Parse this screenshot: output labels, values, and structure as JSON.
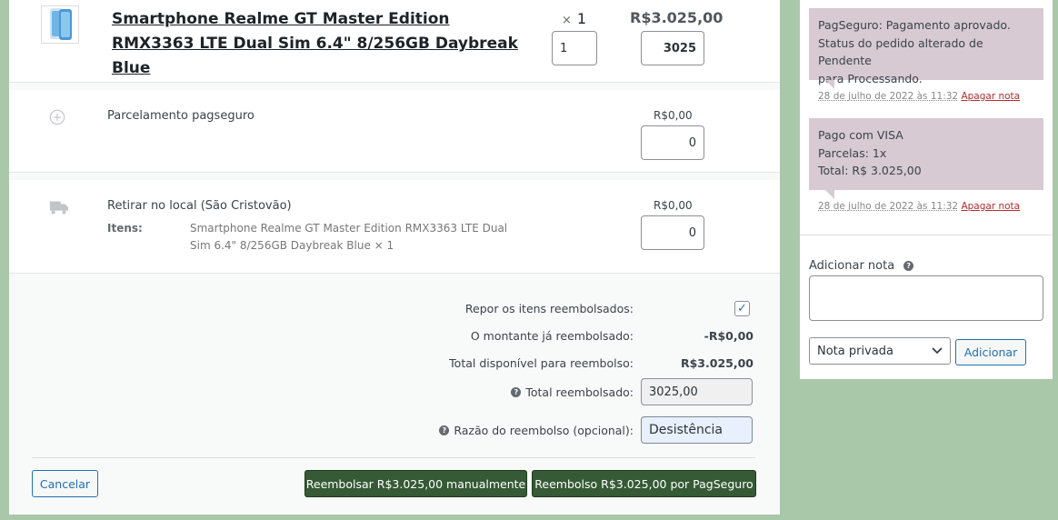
{
  "product": {
    "name": "Smartphone Realme GT Master Edition RMX3363 LTE Dual Sim 6.4\" 8/256GB Daybreak Blue",
    "qty_prefix": "×",
    "qty": "1",
    "price": "R$3.025,00",
    "refund_qty": "1",
    "refund_total": "3025"
  },
  "fee": {
    "title": "Parcelamento pagseguro",
    "amount": "R$0,00",
    "refund": "0"
  },
  "shipping": {
    "title": "Retirar no local (São Cristovão)",
    "items_label": "Itens:",
    "items_value": "Smartphone Realme GT Master Edition RMX3363 LTE Dual Sim 6.4\" 8/256GB Daybreak Blue × 1",
    "amount": "R$0,00",
    "refund": "0"
  },
  "refund_panel": {
    "restock_label": "Repor os itens reembolsados:",
    "restock_checked": "✓",
    "already_label": "O montante já reembolsado:",
    "already_value": "-R$0,00",
    "available_label": "Total disponível para reembolso:",
    "available_value": "R$3.025,00",
    "total_label": "Total reembolsado:",
    "total_value": "3025,00",
    "reason_label": "Razão do reembolso (opcional):",
    "reason_value": "Desistência",
    "cancel_btn": "Cancelar",
    "manual_btn": "Reembolsar R$3.025,00 manualmente",
    "gateway_btn": "Reembolso R$3.025,00 por PagSeguro"
  },
  "notes": [
    {
      "lines": [
        "PagSeguro: Pagamento aprovado.",
        "Status do pedido alterado de Pendente",
        "para Processando."
      ],
      "date": "28 de julho de 2022 às 11:32",
      "delete": "Apagar nota"
    },
    {
      "lines": [
        "Pago com VISA",
        "Parcelas: 1x",
        "Total: R$ 3.025,00"
      ],
      "date": "28 de julho de 2022 às 11:32",
      "delete": "Apagar nota"
    }
  ],
  "add_note": {
    "label": "Adicionar nota",
    "type_selected": "Nota privada",
    "add_btn": "Adicionar"
  },
  "colors": {
    "page_bg": "#a9c8a9",
    "primary_btn": "#355a35",
    "note_bg": "#d7cad2",
    "link": "#2271b1",
    "delete_link": "#b32d2e"
  }
}
